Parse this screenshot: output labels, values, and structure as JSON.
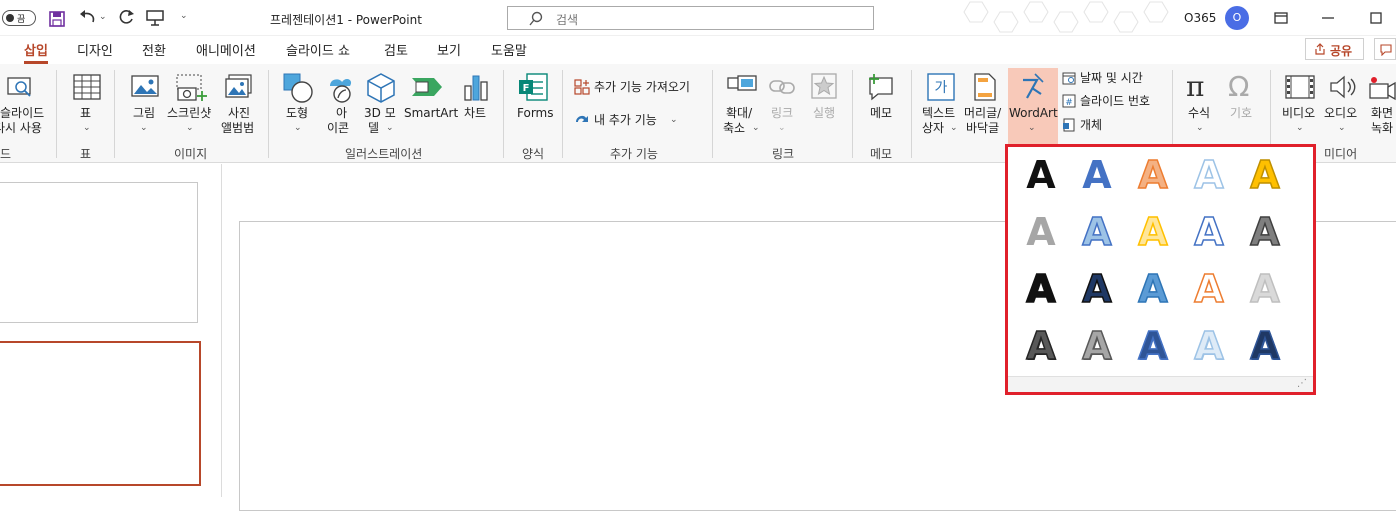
{
  "titlebar": {
    "autosave_label": "끔",
    "doc_title": "프레젠테이션1  -  PowerPoint",
    "search_placeholder": "검색",
    "account_label": "O365",
    "avatar_initial": "O"
  },
  "tabs": [
    "삽입",
    "디자인",
    "전환",
    "애니메이션",
    "슬라이드 쇼",
    "검토",
    "보기",
    "도움말"
  ],
  "share": {
    "label": "공유"
  },
  "ribbon": {
    "reuse": {
      "line1": "슬라이드",
      "line2": "다시 사용",
      "group": "드"
    },
    "table": {
      "label": "표",
      "group": "표"
    },
    "images": {
      "picture": "그림",
      "screenshot": "스크린샷",
      "album_line1": "사진",
      "album_line2": "앨범범",
      "group": "이미지"
    },
    "illustrations": {
      "shapes": "도형",
      "icons_line1": "아",
      "icons_line2": "이콘",
      "model_line1": "3D 모",
      "model_line2": "델",
      "smartart": "SmartArt",
      "chart": "차트",
      "group": "일러스트레이션"
    },
    "forms": {
      "label": "Forms",
      "group": "양식"
    },
    "addins": {
      "get": "추가 기능 가져오기",
      "mine": "내 추가 기능",
      "group": "추가 기능"
    },
    "links": {
      "zoom_line1": "확대/",
      "zoom_line2": "축소",
      "link": "링크",
      "action": "실행",
      "group": "링크"
    },
    "comments": {
      "label": "메모",
      "group": "메모"
    },
    "text": {
      "textbox_line1": "텍스트",
      "textbox_line2": "상자",
      "header_line1": "머리글/",
      "header_line2": "바닥글",
      "wordart": "WordArt",
      "datetime": "날짜 및 시간",
      "slide_number": "슬라이드 번호",
      "object": "개체"
    },
    "symbols": {
      "equation": "수식",
      "symbol": "기호"
    },
    "media": {
      "video": "비디오",
      "audio": "오디오",
      "record_line1": "화면",
      "record_line2": "녹화",
      "group": "미디어"
    }
  },
  "wordart": {
    "glyph": "A",
    "styles": [
      {
        "fill": "#111111",
        "stroke": "none"
      },
      {
        "fill": "#4472c4",
        "stroke": "none"
      },
      {
        "fill": "#f4b183",
        "stroke": "#ed7d31"
      },
      {
        "fill": "#ffffff",
        "stroke": "#9dc3e6"
      },
      {
        "fill": "#ffc000",
        "stroke": "#bf9000"
      },
      {
        "fill": "#a6a6a6",
        "stroke": "none"
      },
      {
        "fill": "#9dc3e6",
        "stroke": "#4472c4"
      },
      {
        "fill": "#ffe699",
        "stroke": "#ffc000"
      },
      {
        "fill": "#ffffff",
        "stroke": "#4472c4"
      },
      {
        "fill": "#7f7f7f",
        "stroke": "#404040"
      },
      {
        "fill": "#111111",
        "stroke": "#111111"
      },
      {
        "fill": "#1f3864",
        "stroke": "#111111"
      },
      {
        "fill": "#5b9bd5",
        "stroke": "#2e75b6"
      },
      {
        "fill": "#ffffff",
        "stroke": "#ed7d31"
      },
      {
        "fill": "#d9d9d9",
        "stroke": "#bfbfbf"
      },
      {
        "fill": "#595959",
        "stroke": "#262626"
      },
      {
        "fill": "#a6a6a6",
        "stroke": "#595959"
      },
      {
        "fill": "#2f5597",
        "stroke": "#4472c4"
      },
      {
        "fill": "#deebf7",
        "stroke": "#9dc3e6"
      },
      {
        "fill": "#1f3864",
        "stroke": "#2f5597"
      }
    ]
  },
  "colors": {
    "accent": "#b7472a",
    "highlight": "#e0202b",
    "wordart_active": "#f8c9b9"
  }
}
